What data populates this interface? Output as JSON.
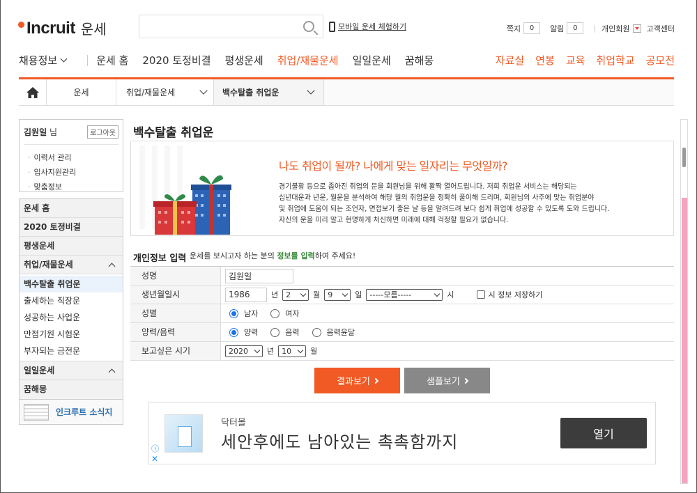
{
  "header": {
    "brand": "Incruit",
    "brand_sub": "운세",
    "mobile_link": "모바일 운세 체험하기",
    "util": {
      "message_label": "쪽지",
      "message_count": "0",
      "alert_label": "알림",
      "alert_count": "0",
      "member_label": "개인회원",
      "support_label": "고객센터"
    }
  },
  "gnb": {
    "items": [
      "채용정보",
      "운세 홈",
      "2020 토정비결",
      "평생운세",
      "취업/재물운세",
      "일일운세",
      "꿈해몽"
    ],
    "right_items": [
      "자료실",
      "연봉",
      "교육",
      "취업학교",
      "공모전"
    ]
  },
  "breadcrumb": {
    "level1": "운세",
    "level2": "취업/재물운세",
    "level3": "백수탈출 취업운"
  },
  "sidebar": {
    "user_name": "김원일",
    "user_suffix": "님",
    "logout": "로그아웃",
    "links": [
      "이력서 관리",
      "입사지원관리",
      "맞춤정보"
    ],
    "menu": {
      "home": "운세 홈",
      "tojung": "2020 토정비결",
      "lifetime": "평생운세",
      "job": "취업/재물운세",
      "job_sub": [
        "백수탈출 취업운",
        "출세하는 직장운",
        "성공하는 사업운",
        "만점기원 시험운",
        "부자되는 금전운"
      ],
      "daily": "일일운세",
      "dream": "꿈해몽"
    },
    "news": "인크루트 소식지"
  },
  "main": {
    "title": "백수탈출 취업운",
    "intro_head": "나도 취업이 될까? 나에게 맞는 일자리는 무엇일까?",
    "intro_lines": [
      "경기불황 등으로 좁아진 취업의 문을 회원님을 위해 활짝 열어드립니다. 저희 취업운 서비스는 해당되는",
      "십년대운과 년운, 월운을 분석하여 해당 월의 취업운을 정확히 풀이해 드리며, 회원님의 사주에 맞는 취업분야",
      "및 취업에 도움이 되는 조언자, 면접보기 좋은 날 등을 알려드려 보다 쉽게 취업에 성공할 수 있도록 도와 드립니다.",
      "자신의 운을 미리 알고 현명하게 처신하면 미래에 대해 걱정할 필요가 없습니다."
    ]
  },
  "form": {
    "title": "개인정보 입력",
    "sub_pre": "운세를 보시고자 하는 분의 ",
    "sub_bold": "정보를 입력",
    "sub_post": "하여 주세요!",
    "rows": {
      "name_label": "성명",
      "name_value": "김원일",
      "birth_label": "생년월일시",
      "birth_year": "1986",
      "year_unit": "년",
      "birth_month": "2",
      "month_unit": "월",
      "birth_day": "9",
      "day_unit": "일",
      "birth_hour": "-----모름-----",
      "hour_unit": "시",
      "save_time": "시 정보 저장하기",
      "gender_label": "성별",
      "male": "남자",
      "female": "여자",
      "calendar_label": "양력/음력",
      "solar": "양력",
      "lunar": "음력",
      "lunar_leap": "음력윤달",
      "period_label": "보고싶은 시기",
      "period_year": "2020",
      "period_month": "10"
    },
    "result_btn": "결과보기",
    "sample_btn": "샘플보기"
  },
  "ad": {
    "brand": "닥터몰",
    "copy": "세안후에도 남아있는 촉촉함까지",
    "open": "열기"
  }
}
